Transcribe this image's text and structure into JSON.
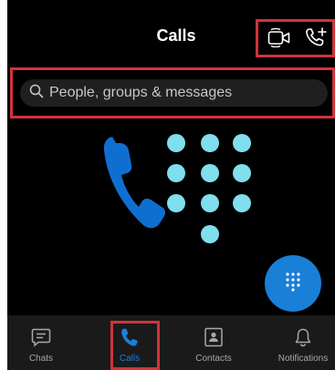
{
  "header": {
    "title": "Calls",
    "actions": [
      {
        "icon": "video-call-icon"
      },
      {
        "icon": "add-call-icon"
      }
    ]
  },
  "search": {
    "placeholder": "People, groups & messages",
    "icon": "search-icon"
  },
  "illustration": {
    "icon": "phone-keypad-illustration",
    "colors": {
      "handset": "#0f6fd1",
      "dots": "#7fdfec"
    }
  },
  "fab": {
    "icon": "dialpad-icon",
    "color": "#1a7fd6"
  },
  "nav": {
    "items": [
      {
        "label": "Chats",
        "icon": "chat-icon",
        "active": false
      },
      {
        "label": "Calls",
        "icon": "phone-icon",
        "active": true
      },
      {
        "label": "Contacts",
        "icon": "contacts-icon",
        "active": false
      },
      {
        "label": "Notifications",
        "icon": "bell-icon",
        "active": false
      }
    ]
  },
  "colors": {
    "background": "#000000",
    "accent": "#1a7fd6",
    "highlight": "#d0343a"
  }
}
